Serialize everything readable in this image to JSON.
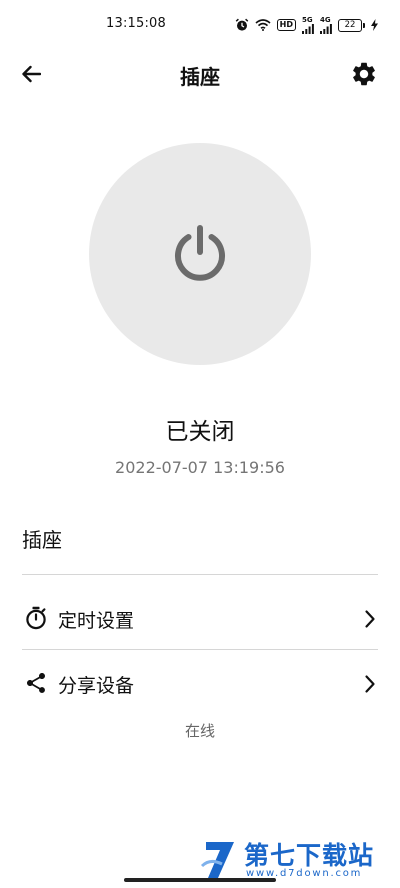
{
  "status_bar": {
    "time": "13:15:08",
    "hd_label": "HD",
    "signal_1_label": "5G",
    "signal_2_label": "4G",
    "battery": "22",
    "icons": [
      "alarm-icon",
      "wifi-icon",
      "hd-icon",
      "signal-icon",
      "signal-icon",
      "battery-icon",
      "charging-icon"
    ]
  },
  "header": {
    "title": "插座",
    "back_icon": "arrow-left-icon",
    "settings_icon": "gear-icon"
  },
  "power": {
    "icon": "power-icon",
    "status": "已关闭",
    "timestamp": "2022-07-07 13:19:56",
    "circle_color": "#e9e9e9",
    "icon_color": "#6b6b6b"
  },
  "device": {
    "name": "插座"
  },
  "menu": {
    "timer": {
      "label": "定时设置",
      "icon": "stopwatch-icon"
    },
    "share": {
      "label": "分享设备",
      "icon": "share-icon"
    }
  },
  "online_status": "在线",
  "watermark": {
    "title": "第七下载站",
    "url": "www.d7down.com",
    "color": "#1b67c9"
  }
}
